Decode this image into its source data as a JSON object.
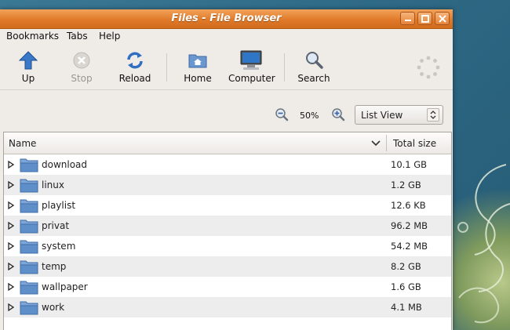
{
  "window": {
    "title": "Files - File Browser"
  },
  "menu": [
    "Bookmarks",
    "Tabs",
    "Help"
  ],
  "toolbar": {
    "up": "Up",
    "stop": "Stop",
    "reload": "Reload",
    "home": "Home",
    "computer": "Computer",
    "search": "Search"
  },
  "zoom": {
    "level": "50%"
  },
  "view_select": {
    "value": "List View"
  },
  "columns": {
    "name": "Name",
    "size": "Total size"
  },
  "rows": [
    {
      "name": "download",
      "size": "10.1 GB"
    },
    {
      "name": "linux",
      "size": "1.2 GB"
    },
    {
      "name": "playlist",
      "size": "12.6 KB"
    },
    {
      "name": "privat",
      "size": "96.2 MB"
    },
    {
      "name": "system",
      "size": "54.2 MB"
    },
    {
      "name": "temp",
      "size": "8.2 GB"
    },
    {
      "name": "wallpaper",
      "size": "1.6 GB"
    },
    {
      "name": "work",
      "size": "4.1 MB"
    }
  ],
  "colors": {
    "titlebar": "#e07a2a",
    "folder": "#5f8fc9",
    "row_alt": "#ededed"
  }
}
